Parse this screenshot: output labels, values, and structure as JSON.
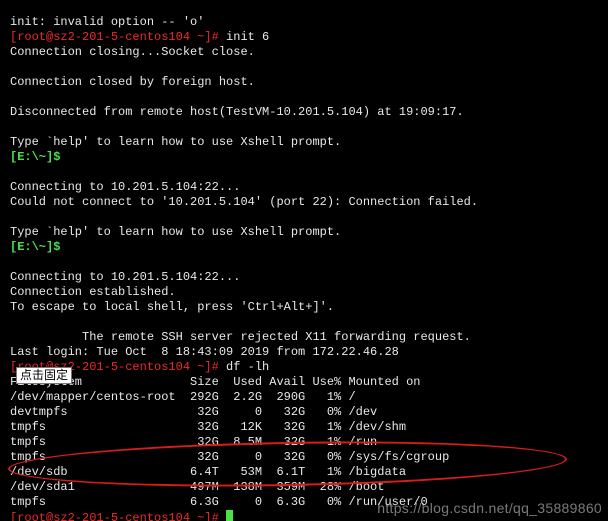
{
  "lines": {
    "l0": "init: invalid option -- 'o'",
    "l1_host": "[root@sz2-201-5-centos104 ~]#",
    "l1_cmd": " init 6",
    "l2": "Connection closing...Socket close.",
    "l3": "",
    "l4": "Connection closed by foreign host.",
    "l5": "",
    "l6": "Disconnected from remote host(TestVM-10.201.5.104) at 19:09:17.",
    "l7": "",
    "l8": "Type `help' to learn how to use Xshell prompt.",
    "l9_pr": "[E:\\~]$",
    "l9_rest": " ",
    "l10": "",
    "l11": "Connecting to 10.201.5.104:22...",
    "l12": "Could not connect to '10.201.5.104' (port 22): Connection failed.",
    "l13": "",
    "l14": "Type `help' to learn how to use Xshell prompt.",
    "l15_pr": "[E:\\~]$",
    "l15_rest": " ",
    "l16": "",
    "l17": "Connecting to 10.201.5.104:22...",
    "l18": "Connection established.",
    "l19": "To escape to local shell, press 'Ctrl+Alt+]'.",
    "l20": "",
    "l21_pre": "          ",
    "l21_rest": "The remote SSH server rejected X11 forwarding request.",
    "l22": "Last login: Tue Oct  8 18:43:09 2019 from 172.22.46.28",
    "l23_host": "[root@sz2-201-5-centos104 ~]#",
    "l23_cmd": " df -lh",
    "l24": "Filesystem               Size  Used Avail Use% Mounted on",
    "l25": "/dev/mapper/centos-root  292G  2.2G  290G   1% /",
    "l26": "devtmpfs                  32G     0   32G   0% /dev",
    "l27": "tmpfs                     32G   12K   32G   1% /dev/shm",
    "l28": "tmpfs                     32G  8.5M   32G   1% /run",
    "l29": "tmpfs                     32G     0   32G   0% /sys/fs/cgroup",
    "l30": "/dev/sdb                 6.4T   53M  6.1T   1% /bigdata",
    "l31": "/dev/sda1                497M  138M  359M  28% /boot",
    "l32": "tmpfs                    6.3G     0  6.3G   0% /run/user/0",
    "l33_host": "[root@sz2-201-5-centos104 ~]#",
    "l33_cmd": " "
  },
  "tooltip": "点击固定",
  "watermark": "https://blog.csdn.net/qq_35889860"
}
